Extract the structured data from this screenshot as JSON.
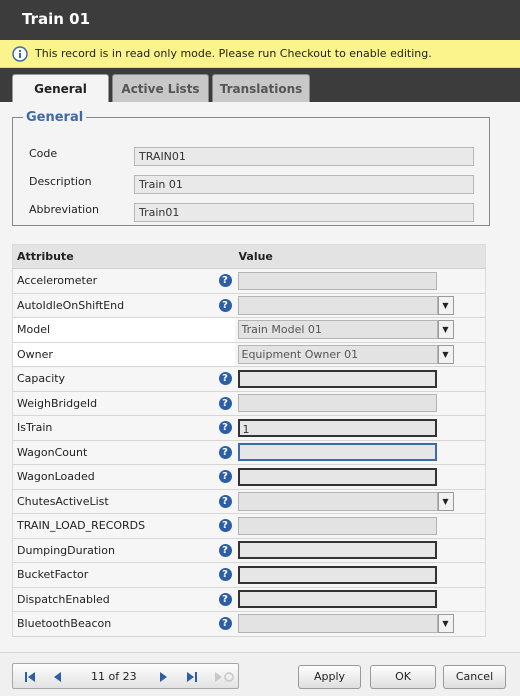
{
  "window": {
    "title": "Train 01"
  },
  "notice": {
    "message": "This record is in read only mode. Please run Checkout to enable editing."
  },
  "tabs": [
    {
      "label": "General"
    },
    {
      "label": "Active Lists"
    },
    {
      "label": "Translations"
    }
  ],
  "general": {
    "legend": "General",
    "fields": [
      {
        "label": "Code",
        "value": "TRAIN01"
      },
      {
        "label": "Description",
        "value": "Train 01"
      },
      {
        "label": "Abbreviation",
        "value": "Train01"
      }
    ]
  },
  "attributes": {
    "header_attribute": "Attribute",
    "header_value": "Value",
    "rows": [
      {
        "name": "Accelerometer",
        "value": ""
      },
      {
        "name": "AutoIdleOnShiftEnd",
        "value": ""
      },
      {
        "name": "Model",
        "value": "Train Model 01"
      },
      {
        "name": "Owner",
        "value": "Equipment Owner 01"
      },
      {
        "name": "Capacity",
        "value": ""
      },
      {
        "name": "WeighBridgeId",
        "value": ""
      },
      {
        "name": "IsTrain",
        "value": "1"
      },
      {
        "name": "WagonCount",
        "value": ""
      },
      {
        "name": "WagonLoaded",
        "value": ""
      },
      {
        "name": "ChutesActiveList",
        "value": ""
      },
      {
        "name": "TRAIN_LOAD_RECORDS",
        "value": ""
      },
      {
        "name": "DumpingDuration",
        "value": ""
      },
      {
        "name": "BucketFactor",
        "value": ""
      },
      {
        "name": "DispatchEnabled",
        "value": ""
      },
      {
        "name": "BluetoothBeacon",
        "value": ""
      }
    ]
  },
  "pager": {
    "text": "11 of 23"
  },
  "buttons": {
    "apply": "Apply",
    "ok": "OK",
    "cancel": "Cancel"
  },
  "icons": {
    "help": "?",
    "dropdown": "▼"
  },
  "colors": {
    "titlebar": "#3c3c3c",
    "notice": "#fbf48c",
    "accent": "#3f6aa8",
    "help_icon": "#2c5ea6"
  }
}
